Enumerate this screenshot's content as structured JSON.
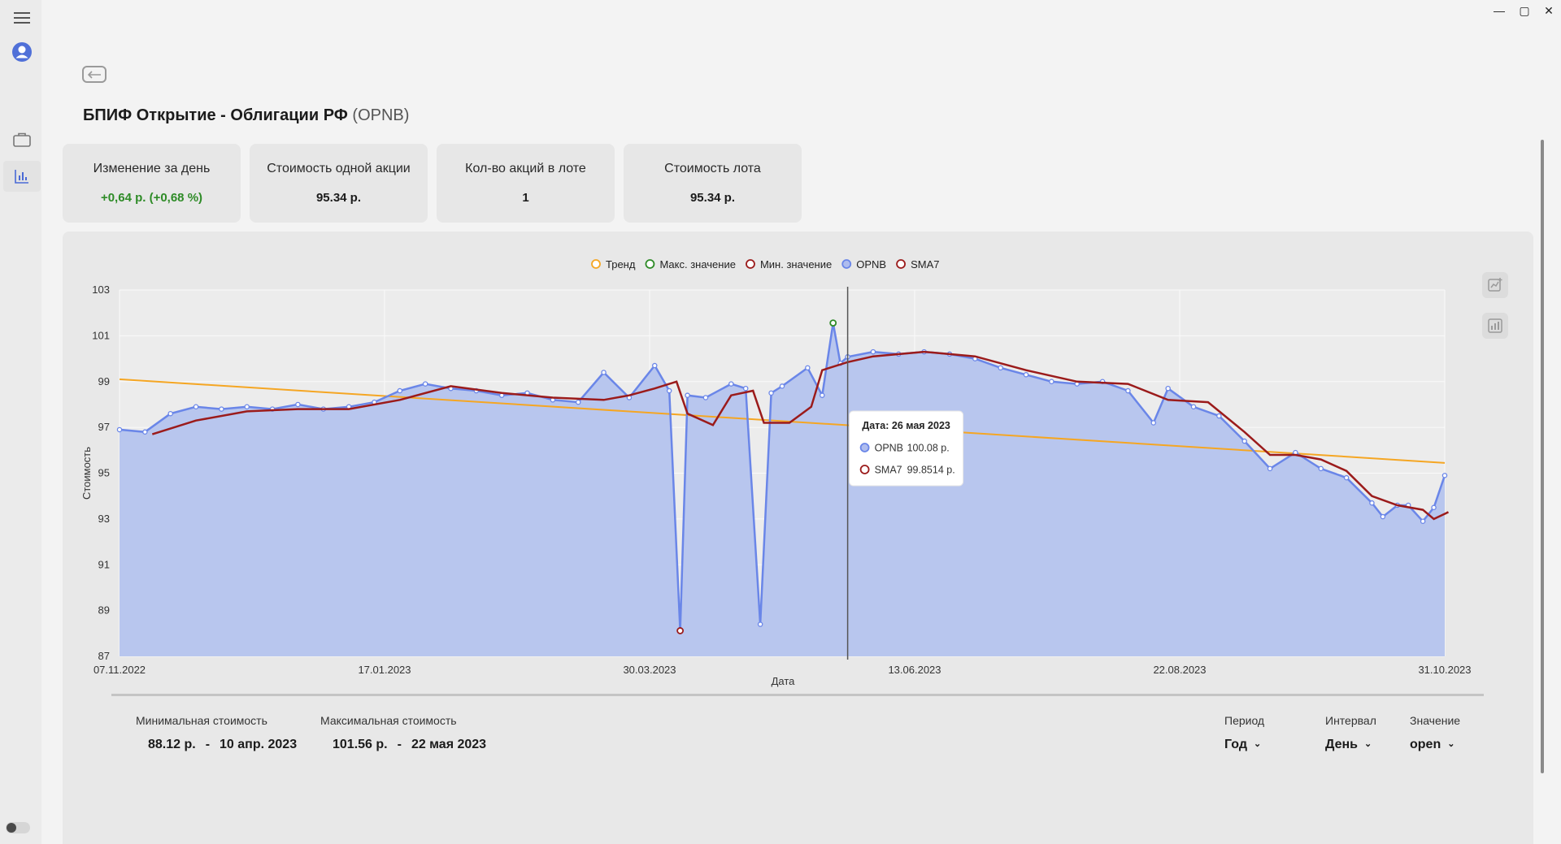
{
  "window": {
    "minimize": "—",
    "maximize": "▢",
    "close": "✕"
  },
  "sidebar": {
    "icons": [
      "menu-icon",
      "user-icon",
      "briefcase-icon",
      "chart-icon"
    ]
  },
  "header": {
    "title": "БПИФ Открытие - Облигации РФ",
    "ticker": "(OPNB)"
  },
  "cards": [
    {
      "label": "Изменение за день",
      "value": "+0,64 р. (+0,68 %)"
    },
    {
      "label": "Стоимость одной акции",
      "value": "95.34 р."
    },
    {
      "label": "Кол-во акций в лоте",
      "value": "1"
    },
    {
      "label": "Стоимость лота",
      "value": "95.34 р."
    }
  ],
  "colors": {
    "series": "#6a86e8",
    "area": "#b8c6ee",
    "sma": "#9b1b1b",
    "trend": "#f5a623",
    "max": "#2e8b27",
    "positive": "#2e8b27"
  },
  "chart_data": {
    "type": "line",
    "xlabel": "Дата",
    "ylabel": "Стоимость",
    "ylim": [
      87,
      103
    ],
    "yticks": [
      87,
      89,
      91,
      93,
      95,
      97,
      99,
      101,
      103
    ],
    "xticks": [
      "07.11.2022",
      "17.01.2023",
      "30.03.2023",
      "13.06.2023",
      "22.08.2023",
      "31.10.2023"
    ],
    "legend": [
      "Тренд",
      "Макс. значение",
      "Мин. значение",
      "OPNB",
      "SMA7"
    ],
    "x_range": [
      "2022-11-07",
      "2023-11-06"
    ],
    "series": [
      {
        "name": "OPNB",
        "points": [
          [
            "2022-11-07",
            96.9
          ],
          [
            "2022-11-14",
            96.8
          ],
          [
            "2022-11-21",
            97.6
          ],
          [
            "2022-11-28",
            97.9
          ],
          [
            "2022-12-05",
            97.8
          ],
          [
            "2022-12-12",
            97.9
          ],
          [
            "2022-12-19",
            97.8
          ],
          [
            "2022-12-26",
            98.0
          ],
          [
            "2023-01-02",
            97.8
          ],
          [
            "2023-01-09",
            97.9
          ],
          [
            "2023-01-16",
            98.1
          ],
          [
            "2023-01-23",
            98.6
          ],
          [
            "2023-01-30",
            98.9
          ],
          [
            "2023-02-06",
            98.7
          ],
          [
            "2023-02-13",
            98.6
          ],
          [
            "2023-02-20",
            98.4
          ],
          [
            "2023-02-27",
            98.5
          ],
          [
            "2023-03-06",
            98.2
          ],
          [
            "2023-03-13",
            98.1
          ],
          [
            "2023-03-20",
            99.4
          ],
          [
            "2023-03-27",
            98.3
          ],
          [
            "2023-04-03",
            99.7
          ],
          [
            "2023-04-07",
            98.6
          ],
          [
            "2023-04-10",
            88.12
          ],
          [
            "2023-04-12",
            98.4
          ],
          [
            "2023-04-17",
            98.3
          ],
          [
            "2023-04-24",
            98.9
          ],
          [
            "2023-04-28",
            98.7
          ],
          [
            "2023-05-02",
            88.4
          ],
          [
            "2023-05-05",
            98.5
          ],
          [
            "2023-05-08",
            98.8
          ],
          [
            "2023-05-15",
            99.6
          ],
          [
            "2023-05-19",
            98.4
          ],
          [
            "2023-05-22",
            101.56
          ],
          [
            "2023-05-24",
            99.8
          ],
          [
            "2023-05-26",
            100.08
          ],
          [
            "2023-06-02",
            100.3
          ],
          [
            "2023-06-09",
            100.2
          ],
          [
            "2023-06-16",
            100.3
          ],
          [
            "2023-06-23",
            100.2
          ],
          [
            "2023-06-30",
            100.0
          ],
          [
            "2023-07-07",
            99.6
          ],
          [
            "2023-07-14",
            99.3
          ],
          [
            "2023-07-21",
            99.0
          ],
          [
            "2023-07-28",
            98.9
          ],
          [
            "2023-08-04",
            99.0
          ],
          [
            "2023-08-11",
            98.6
          ],
          [
            "2023-08-18",
            97.2
          ],
          [
            "2023-08-22",
            98.7
          ],
          [
            "2023-08-29",
            97.9
          ],
          [
            "2023-09-05",
            97.5
          ],
          [
            "2023-09-12",
            96.4
          ],
          [
            "2023-09-19",
            95.2
          ],
          [
            "2023-09-26",
            95.9
          ],
          [
            "2023-10-03",
            95.2
          ],
          [
            "2023-10-10",
            94.8
          ],
          [
            "2023-10-17",
            93.7
          ],
          [
            "2023-10-20",
            93.1
          ],
          [
            "2023-10-24",
            93.6
          ],
          [
            "2023-10-27",
            93.6
          ],
          [
            "2023-10-31",
            92.9
          ],
          [
            "2023-11-03",
            93.5
          ],
          [
            "2023-11-06",
            94.9
          ]
        ]
      },
      {
        "name": "SMA7",
        "points": [
          [
            "2022-11-16",
            96.7
          ],
          [
            "2022-11-28",
            97.3
          ],
          [
            "2022-12-12",
            97.7
          ],
          [
            "2022-12-26",
            97.8
          ],
          [
            "2023-01-09",
            97.8
          ],
          [
            "2023-01-23",
            98.2
          ],
          [
            "2023-02-06",
            98.8
          ],
          [
            "2023-02-20",
            98.5
          ],
          [
            "2023-03-06",
            98.3
          ],
          [
            "2023-03-20",
            98.2
          ],
          [
            "2023-03-27",
            98.4
          ],
          [
            "2023-04-03",
            98.7
          ],
          [
            "2023-04-09",
            99.0
          ],
          [
            "2023-04-12",
            97.6
          ],
          [
            "2023-04-19",
            97.1
          ],
          [
            "2023-04-24",
            98.4
          ],
          [
            "2023-04-30",
            98.6
          ],
          [
            "2023-05-03",
            97.2
          ],
          [
            "2023-05-10",
            97.2
          ],
          [
            "2023-05-16",
            97.9
          ],
          [
            "2023-05-19",
            99.5
          ],
          [
            "2023-05-26",
            99.85
          ],
          [
            "2023-06-02",
            100.1
          ],
          [
            "2023-06-16",
            100.3
          ],
          [
            "2023-06-30",
            100.1
          ],
          [
            "2023-07-14",
            99.5
          ],
          [
            "2023-07-28",
            99.0
          ],
          [
            "2023-08-11",
            98.9
          ],
          [
            "2023-08-22",
            98.2
          ],
          [
            "2023-09-02",
            98.1
          ],
          [
            "2023-09-12",
            96.8
          ],
          [
            "2023-09-19",
            95.8
          ],
          [
            "2023-09-26",
            95.8
          ],
          [
            "2023-10-03",
            95.6
          ],
          [
            "2023-10-10",
            95.1
          ],
          [
            "2023-10-17",
            94.0
          ],
          [
            "2023-10-24",
            93.6
          ],
          [
            "2023-10-31",
            93.4
          ],
          [
            "2023-11-03",
            93.0
          ],
          [
            "2023-11-07",
            93.3
          ]
        ]
      },
      {
        "name": "Тренд",
        "points": [
          [
            "2022-11-07",
            99.1
          ],
          [
            "2023-11-06",
            95.45
          ]
        ]
      }
    ],
    "max_point": [
      "2023-05-22",
      101.56
    ],
    "min_point": [
      "2023-04-10",
      88.12
    ],
    "crosshair_date": "2023-05-26",
    "tooltip": {
      "title": "Дата: 26 мая 2023",
      "rows": [
        {
          "name": "OPNB",
          "value": "100.08 р."
        },
        {
          "name": "SMA7",
          "value": "99.8514 р."
        }
      ]
    }
  },
  "info": {
    "min_label": "Минимальная стоимость",
    "min_value": "88.12 р.",
    "min_sep": "-",
    "min_date": "10 апр. 2023",
    "max_label": "Максимальная стоимость",
    "max_value": "101.56 р.",
    "max_sep": "-",
    "max_date": "22 мая 2023",
    "period_label": "Период",
    "period_value": "Год",
    "interval_label": "Интервал",
    "interval_value": "День",
    "value_label": "Значение",
    "value_value": "open"
  }
}
